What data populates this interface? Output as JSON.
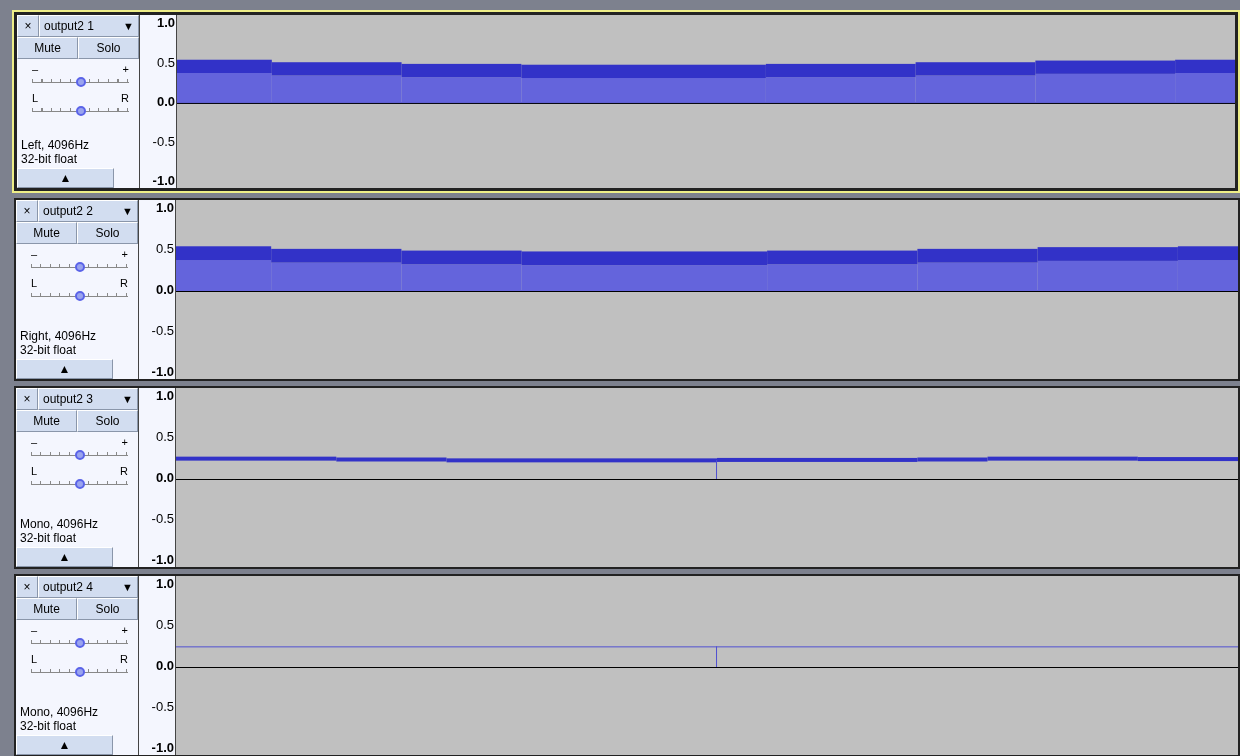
{
  "tracks": [
    {
      "name": "output2 1",
      "close": "×",
      "menu": "▼",
      "selected": true,
      "mute": "Mute",
      "solo": "Solo",
      "gain": {
        "minus": "–",
        "plus": "+",
        "level": 0.5
      },
      "pan": {
        "left": "L",
        "right": "R",
        "level": 0.5
      },
      "info": [
        "Left, 4096Hz",
        "32-bit float"
      ],
      "collapse": "▲",
      "ruler": [
        "1.0",
        "0.5",
        "0.0",
        "-0.5",
        "-1.0"
      ],
      "waveform": {
        "kind": "wide"
      }
    },
    {
      "name": "output2 2",
      "close": "×",
      "menu": "▼",
      "selected": false,
      "mute": "Mute",
      "solo": "Solo",
      "gain": {
        "minus": "–",
        "plus": "+",
        "level": 0.5
      },
      "pan": {
        "left": "L",
        "right": "R",
        "level": 0.5
      },
      "info": [
        "Right, 4096Hz",
        "32-bit float"
      ],
      "collapse": "▲",
      "ruler": [
        "1.0",
        "0.5",
        "0.0",
        "-0.5",
        "-1.0"
      ],
      "waveform": {
        "kind": "wide"
      }
    },
    {
      "name": "output2 3",
      "close": "×",
      "menu": "▼",
      "selected": false,
      "mute": "Mute",
      "solo": "Solo",
      "gain": {
        "minus": "–",
        "plus": "+",
        "level": 0.5
      },
      "pan": {
        "left": "L",
        "right": "R",
        "level": 0.5
      },
      "info": [
        "Mono, 4096Hz",
        "32-bit float"
      ],
      "collapse": "▲",
      "ruler": [
        "1.0",
        "0.5",
        "0.0",
        "-0.5",
        "-1.0"
      ],
      "waveform": {
        "kind": "thin"
      }
    },
    {
      "name": "output2 4",
      "close": "×",
      "menu": "▼",
      "selected": false,
      "mute": "Mute",
      "solo": "Solo",
      "gain": {
        "minus": "–",
        "plus": "+",
        "level": 0.5
      },
      "pan": {
        "left": "L",
        "right": "R",
        "level": 0.5
      },
      "info": [
        "Mono, 4096Hz",
        "32-bit float"
      ],
      "collapse": "▲",
      "ruler": [
        "1.0",
        "0.5",
        "0.0",
        "-0.5",
        "-1.0"
      ],
      "waveform": {
        "kind": "line"
      }
    }
  ]
}
